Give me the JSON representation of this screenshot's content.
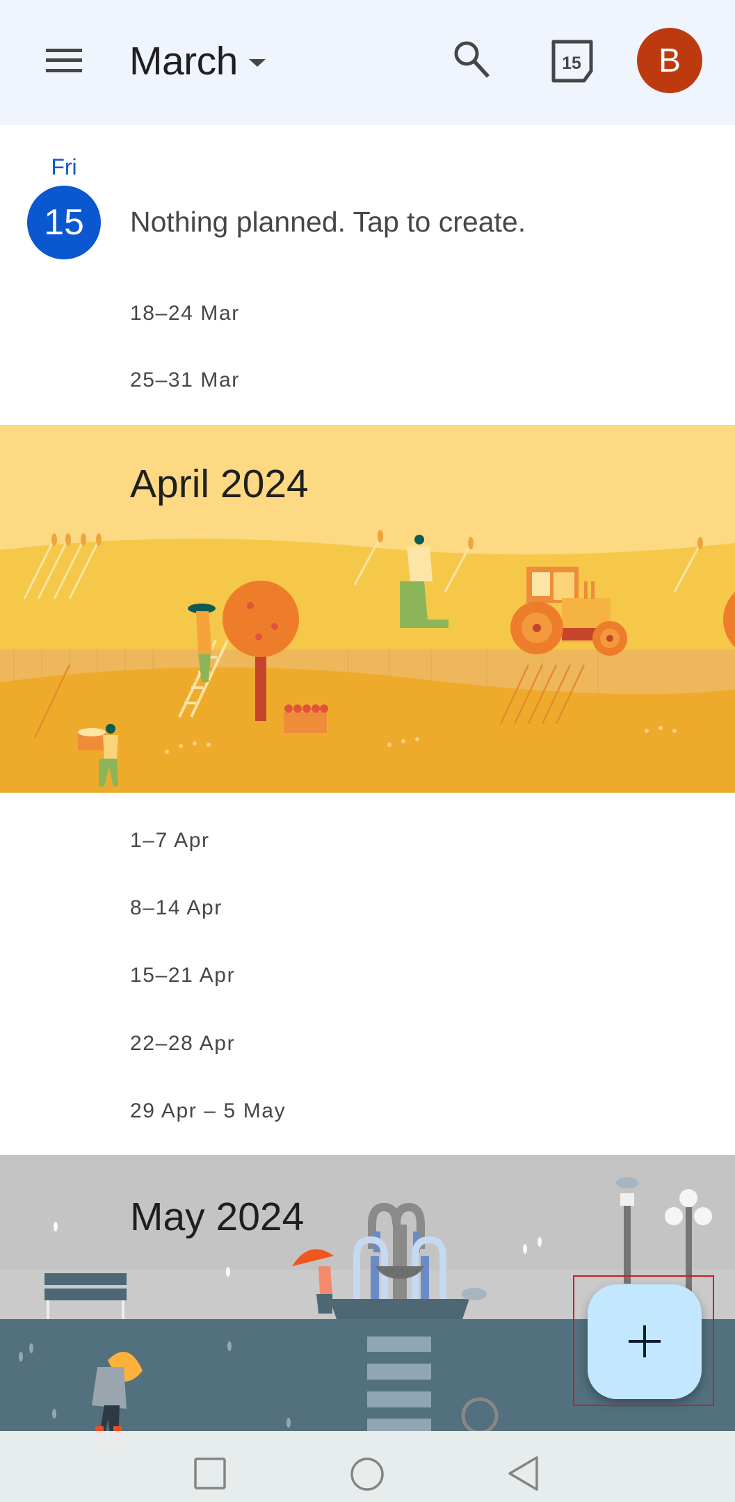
{
  "header": {
    "menu_icon": "hamburger-menu-icon",
    "month": "March",
    "month_caret_icon": "dropdown-caret-icon",
    "search_icon": "search-icon",
    "today_icon": "calendar-today-icon",
    "today_date": "15",
    "avatar_initial": "B",
    "avatar_color": "#bd3a0f"
  },
  "today": {
    "weekday": "Fri",
    "day": "15",
    "message": "Nothing planned. Tap to create.",
    "accent_color": "#0b57d0"
  },
  "march_weeks": [
    "18–24 Mar",
    "25–31 Mar"
  ],
  "april": {
    "title": "April 2024",
    "weeks": [
      "1–7 Apr",
      "8–14 Apr",
      "15–21 Apr",
      "22–28 Apr",
      "29 Apr – 5 May"
    ]
  },
  "may": {
    "title": "May 2024"
  },
  "fab": {
    "icon": "plus-icon",
    "color": "#c2e7ff"
  },
  "navbar": {
    "recents_icon": "recent-apps-icon",
    "home_icon": "home-icon",
    "back_icon": "back-icon"
  }
}
